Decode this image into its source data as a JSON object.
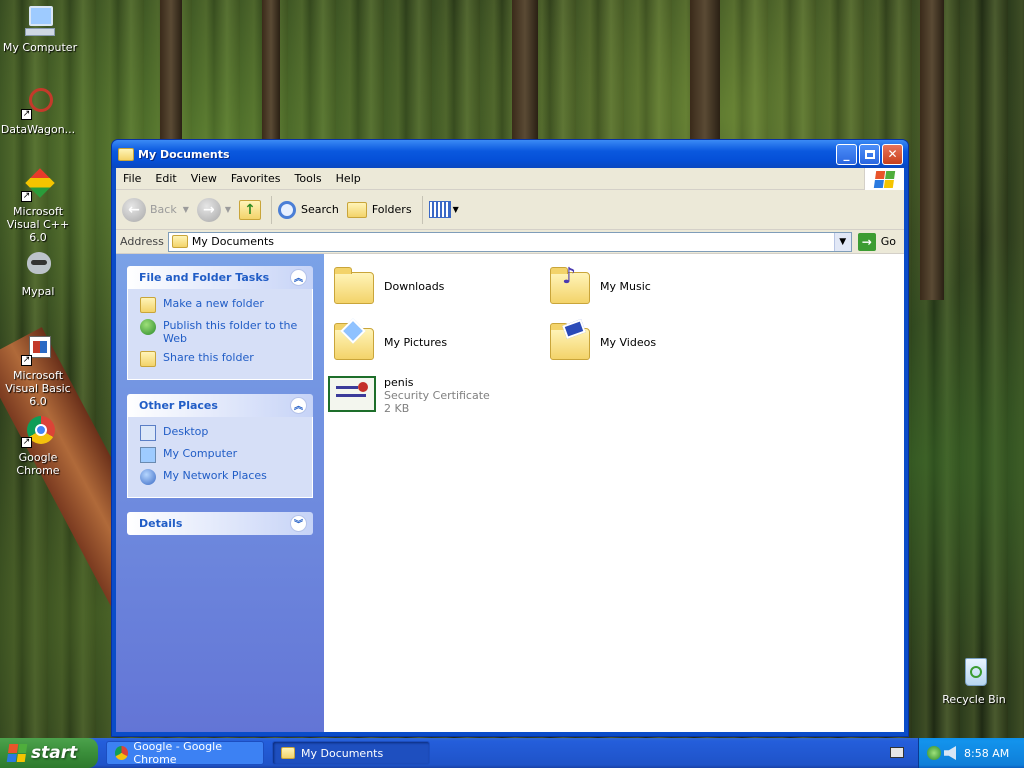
{
  "desktop": {
    "icons": [
      {
        "label": "My Computer"
      },
      {
        "label": "DataWagon..."
      },
      {
        "label": "Microsoft Visual C++ 6.0"
      },
      {
        "label": "Mypal"
      },
      {
        "label": "Microsoft Visual Basic 6.0"
      },
      {
        "label": "Google Chrome"
      },
      {
        "label": "Recycle Bin"
      }
    ]
  },
  "window": {
    "title": "My Documents",
    "menu": [
      "File",
      "Edit",
      "View",
      "Favorites",
      "Tools",
      "Help"
    ],
    "toolbar": {
      "back": "Back",
      "search": "Search",
      "folders": "Folders"
    },
    "address": {
      "label": "Address",
      "value": "My Documents",
      "go": "Go"
    },
    "taskpane": {
      "file_tasks": {
        "title": "File and Folder Tasks",
        "items": [
          "Make a new folder",
          "Publish this folder to the Web",
          "Share this folder"
        ]
      },
      "other_places": {
        "title": "Other Places",
        "items": [
          "Desktop",
          "My Computer",
          "My Network Places"
        ]
      },
      "details": {
        "title": "Details"
      }
    },
    "items": [
      {
        "name": "Downloads"
      },
      {
        "name": "My Music"
      },
      {
        "name": "My Pictures"
      },
      {
        "name": "My Videos"
      },
      {
        "name": "penis",
        "type": "Security Certificate",
        "size": "2 KB"
      }
    ]
  },
  "taskbar": {
    "start": "start",
    "buttons": [
      "Google - Google Chrome",
      "My Documents"
    ],
    "clock": "8:58 AM"
  }
}
